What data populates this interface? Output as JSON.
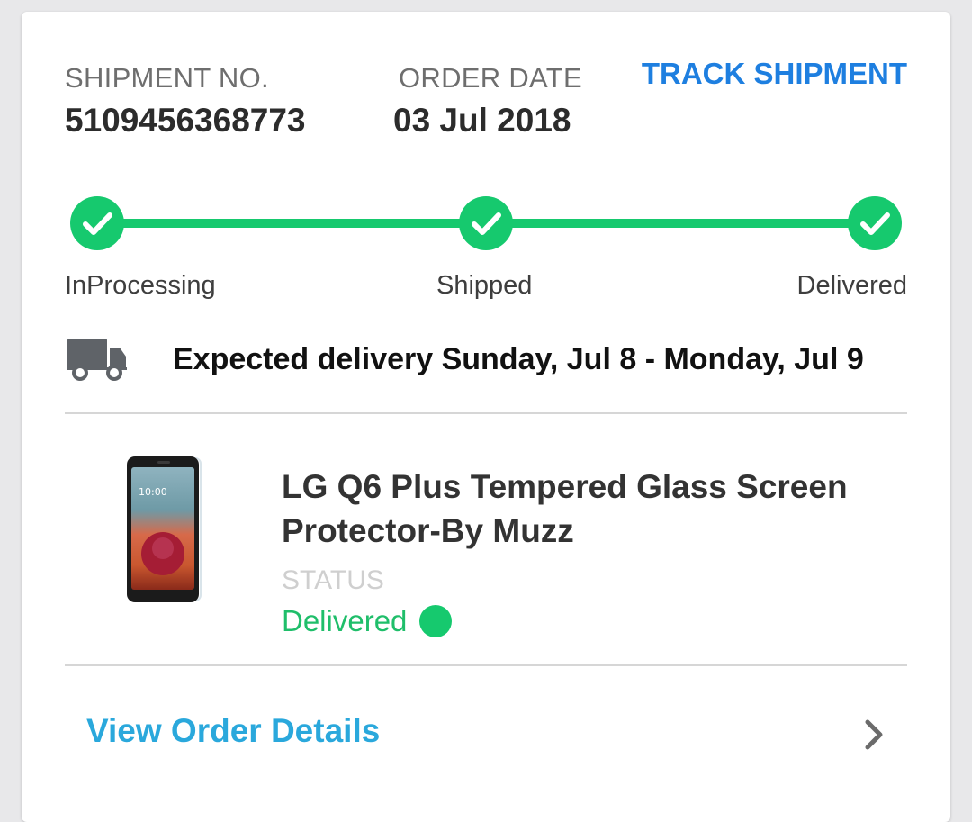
{
  "shipment": {
    "label": "SHIPMENT NO.",
    "number": "5109456368773"
  },
  "order": {
    "label": "ORDER DATE",
    "date": "03 Jul 2018"
  },
  "track_label": "TRACK SHIPMENT",
  "progress": {
    "steps": [
      {
        "label": "InProcessing",
        "completed": true
      },
      {
        "label": "Shipped",
        "completed": true
      },
      {
        "label": "Delivered",
        "completed": true
      }
    ]
  },
  "delivery": {
    "icon": "truck-icon",
    "text": "Expected delivery Sunday, Jul 8 - Monday, Jul 9"
  },
  "product": {
    "title": "LG Q6 Plus Tempered Glass Screen Protector-By Muzz",
    "status_label": "STATUS",
    "status_value": "Delivered"
  },
  "view_details_label": "View Order Details",
  "colors": {
    "accent_blue": "#1e7fe0",
    "link_blue": "#2aa8dc",
    "success_green": "#16c96e",
    "status_green": "#1fbe6a"
  }
}
